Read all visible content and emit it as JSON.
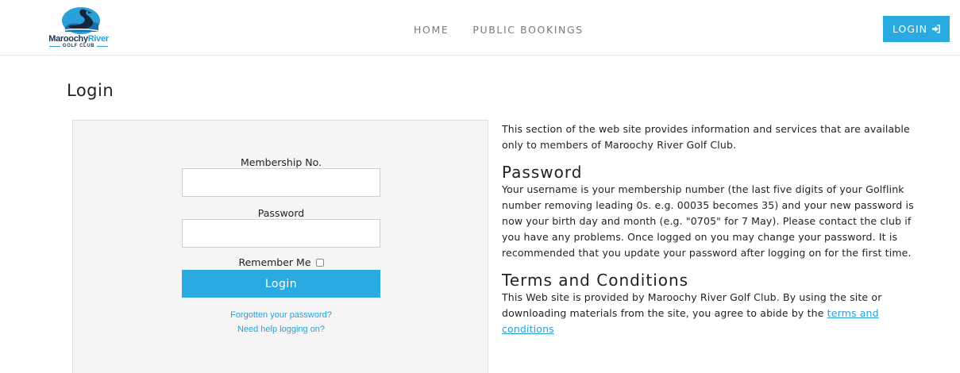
{
  "header": {
    "logo": {
      "line1_part1": "Maroochy",
      "line1_part2": "River",
      "line2": "GOLF CLUB",
      "icon": "swan-logo-icon"
    },
    "nav": [
      {
        "label": "HOME"
      },
      {
        "label": "PUBLIC BOOKINGS"
      }
    ],
    "login_button": {
      "label": "LOGIN",
      "icon": "sign-in-icon"
    }
  },
  "page": {
    "title": "Login"
  },
  "form": {
    "membership_label": "Membership No.",
    "membership_value": "",
    "password_label": "Password",
    "password_value": "",
    "remember_label": "Remember Me",
    "remember_checked": false,
    "submit_label": "Login",
    "forgot_link": "Forgotten your password?",
    "help_link": "Need help logging on?"
  },
  "info": {
    "intro": "This section of the web site provides information and services that are available only to members of Maroochy River Golf Club.",
    "password_heading": "Password",
    "password_text": "Your username is your membership number (the last five digits of your Golflink number removing leading 0s. e.g. 00035 becomes 35) and your new password is now your birth day and month (e.g. \"0705\" for 7 May). Please contact the club if you have any problems. Once logged on you may change your password. It is recommended that you update your password after logging on for the first time.",
    "terms_heading": "Terms and Conditions",
    "terms_text": "This Web site is provided by Maroochy River Golf Club. By using the site or downloading materials from the site, you agree to abide by the",
    "terms_link": "terms and conditions"
  },
  "colors": {
    "accent": "#29aae1",
    "brand_navy": "#1e3553",
    "link": "#2a9fd8",
    "panel_bg": "#f5f5f5"
  }
}
